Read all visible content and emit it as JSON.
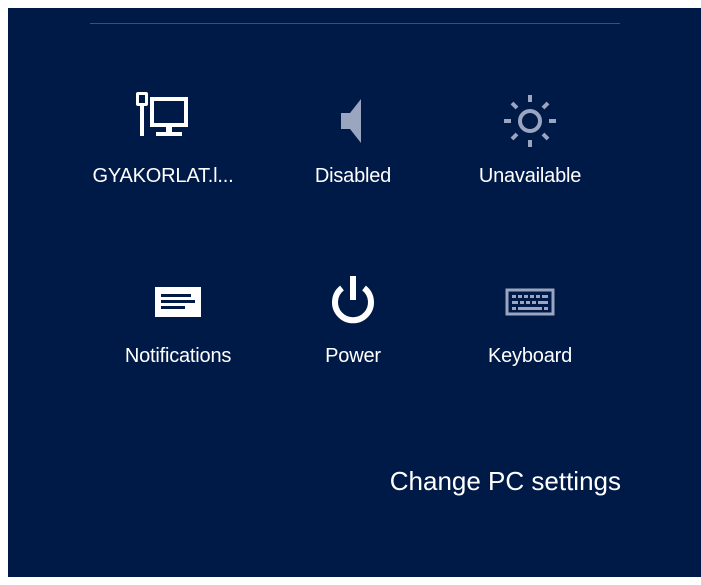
{
  "tiles": {
    "network": {
      "label": "GYAKORLAT.l...",
      "icon": "network-icon"
    },
    "volume": {
      "label": "Disabled",
      "icon": "speaker-icon"
    },
    "brightness": {
      "label": "Unavailable",
      "icon": "brightness-icon"
    },
    "notifications": {
      "label": "Notifications",
      "icon": "notifications-icon"
    },
    "power": {
      "label": "Power",
      "icon": "power-icon"
    },
    "keyboard": {
      "label": "Keyboard",
      "icon": "keyboard-icon"
    }
  },
  "footer": {
    "change_pc_settings": "Change PC settings"
  },
  "colors": {
    "background": "#001a47",
    "foreground": "#ffffff",
    "dimmed_icon": "#9aa5bf",
    "divider": "#3a4f7a"
  }
}
